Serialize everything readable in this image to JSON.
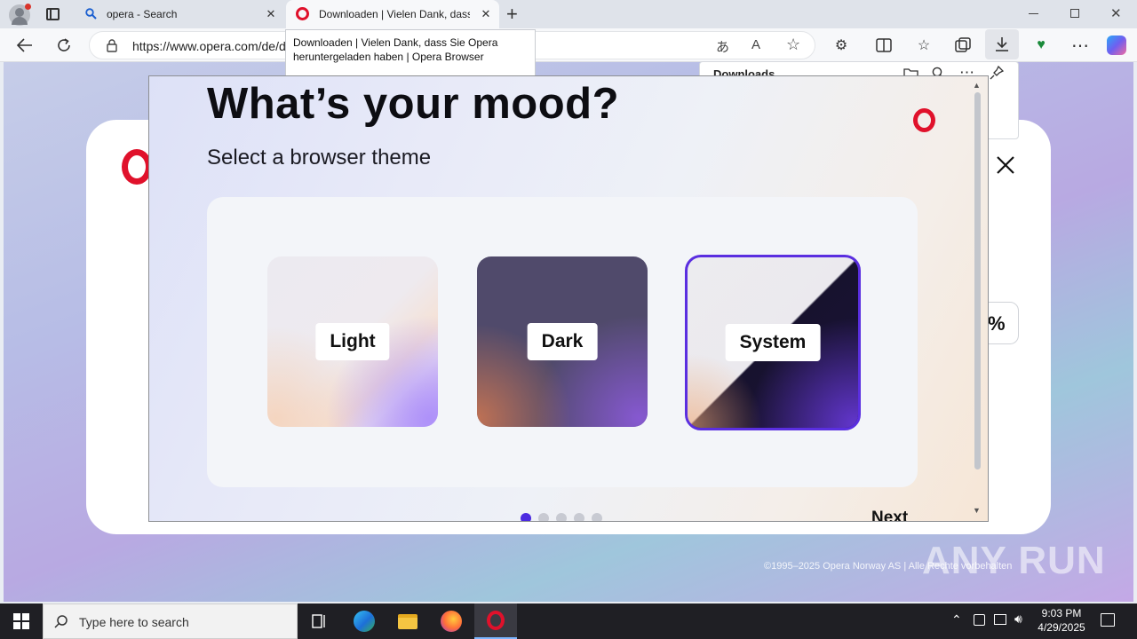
{
  "browser": {
    "tabs": [
      {
        "title": "opera - Search"
      },
      {
        "title": "Downloaden | Vielen Dank, dass S"
      }
    ],
    "new_tab_symbol": "+",
    "url": "https://www.opera.com/de/d",
    "tooltip": "Downloaden | Vielen Dank, dass Sie Opera heruntergeladen haben | Opera Browser",
    "downloads_panel_title": "Downloads"
  },
  "page": {
    "partial_percent": "%",
    "footer_copy": "©1995–2025 Opera Norway AS | Alle Rechte vorbehalten"
  },
  "dialog": {
    "heading": "What’s your mood?",
    "subheading": "Select a browser theme",
    "themes": [
      {
        "label": "Light",
        "selected": false
      },
      {
        "label": "Dark",
        "selected": false
      },
      {
        "label": "System",
        "selected": true
      }
    ],
    "pagination": {
      "total": 5,
      "current": 1
    },
    "next_label": "Next",
    "accent_color": "#5a2ee0",
    "brand_color": "#e0112b"
  },
  "taskbar": {
    "search_placeholder": "Type here to search",
    "time": "9:03 PM",
    "date": "4/29/2025"
  },
  "watermark": "ANY RUN"
}
